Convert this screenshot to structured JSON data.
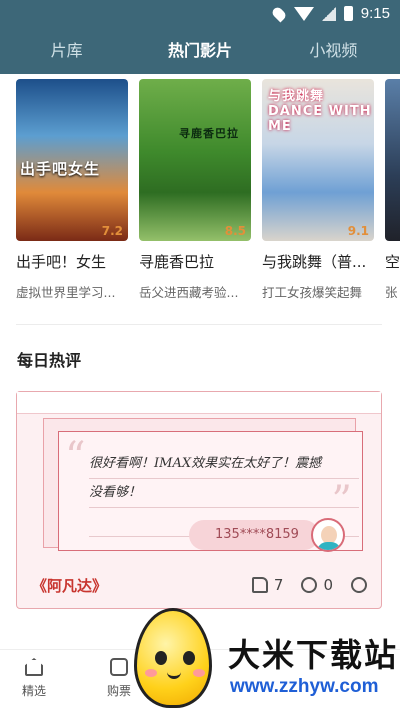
{
  "status_bar": {
    "time": "9:15"
  },
  "tabs": [
    {
      "label": "片库",
      "active": false
    },
    {
      "label": "热门影片",
      "active": true
    },
    {
      "label": "小视频",
      "active": false
    }
  ],
  "movies": [
    {
      "title": "出手吧！女生",
      "rating": "7.2",
      "desc": "虚拟世界里学习...",
      "poster_text": "出手吧女生"
    },
    {
      "title": "寻鹿香巴拉",
      "rating": "8.5",
      "desc": "岳父进西藏考验...",
      "poster_text": "寻鹿香巴拉"
    },
    {
      "title": "与我跳舞（普...",
      "rating": "9.1",
      "desc": "打工女孩爆笑起舞",
      "poster_text": "与我跳舞 DANCE WITH ME"
    },
    {
      "title": "空",
      "rating": "",
      "desc": "张",
      "poster_text": ""
    }
  ],
  "daily_review": {
    "section_title": "每日热评",
    "review_lines": [
      "很好看啊！IMAX效果实在太好了！震撼",
      "没看够！"
    ],
    "user": "135****8159",
    "movie": "《阿凡达》",
    "likes": "7",
    "comments": "0"
  },
  "bottom_nav": [
    {
      "label": "精选"
    },
    {
      "label": "购票"
    }
  ],
  "watermark": {
    "title": "大米下载站",
    "url": "www.zzhyw.com"
  },
  "colors": {
    "header": "#3d6778",
    "accent": "#c8352f",
    "rating": "#e28f3a"
  }
}
